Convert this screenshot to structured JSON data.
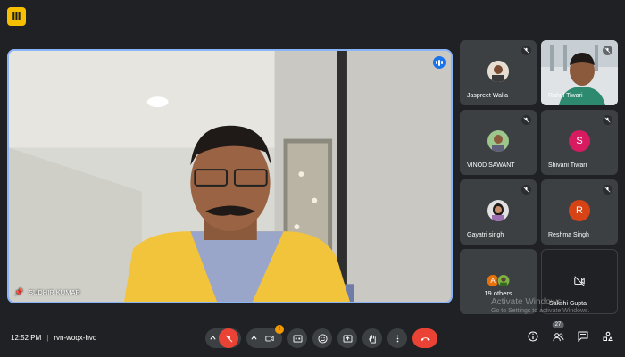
{
  "app": {
    "logo_glyph": "Ⅲ"
  },
  "main_speaker": {
    "name": "SUDHIR KUMAR"
  },
  "participants": [
    {
      "name": "Jaspreet Walia",
      "type": "photo",
      "muted": true
    },
    {
      "name": "Rahul Tiwari",
      "type": "video",
      "muted": true
    },
    {
      "name": "VINOD SAWANT",
      "type": "photo",
      "muted": true
    },
    {
      "name": "Shivani Tiwari",
      "type": "initial",
      "initial": "S",
      "color": "#d81b60",
      "muted": true
    },
    {
      "name": "Gayatri singh",
      "type": "photo",
      "muted": true
    },
    {
      "name": "Reshma Singh",
      "type": "initial",
      "initial": "R",
      "color": "#d84315",
      "muted": true
    },
    {
      "name": "19 others",
      "type": "others",
      "initial": "A",
      "color": "#e8710a"
    },
    {
      "name": "Sakshi Gupta",
      "type": "camera-off"
    }
  ],
  "watermark": {
    "line1": "Activate Windows",
    "line2": "Go to Settings to activate Windows."
  },
  "bottom_bar": {
    "time": "12:52 PM",
    "separator": "|",
    "meeting_code": "rvn-woqx-hvd",
    "present_badge": "!",
    "people_count": "27"
  },
  "colors": {
    "accent": "#8ab4f8",
    "danger": "#ea4335",
    "warning": "#f29900",
    "background": "#202124",
    "tile": "#3c4043"
  }
}
